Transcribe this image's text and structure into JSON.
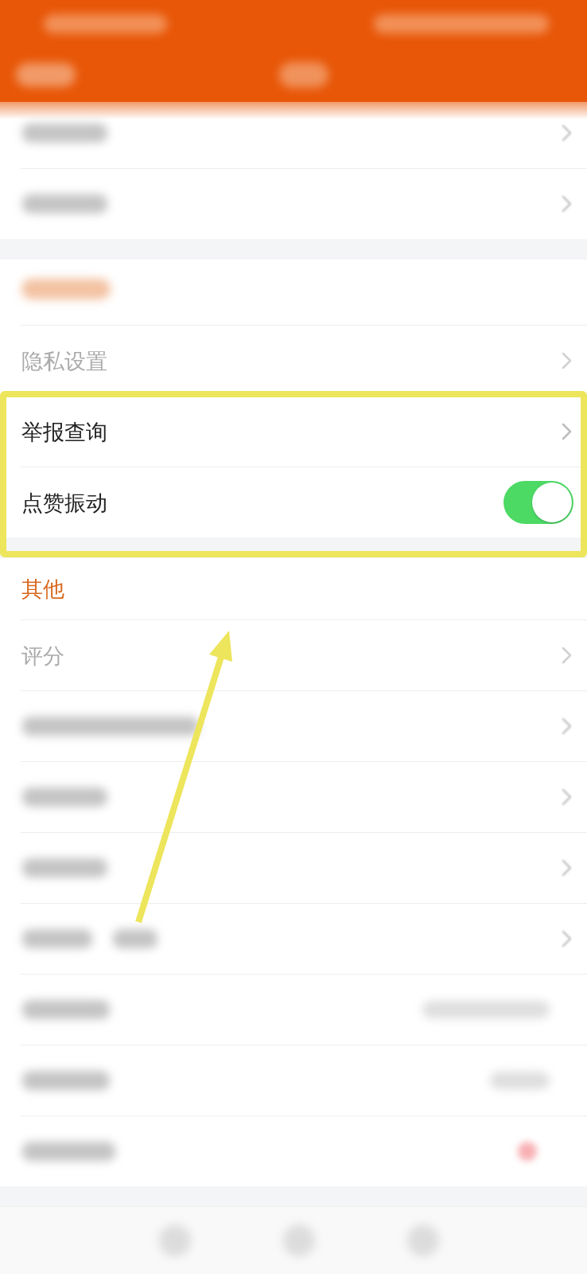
{
  "header": {
    "kind": "blurred"
  },
  "sections": [
    {
      "rows": [
        {
          "kind": "blurred",
          "trailing": {
            "kind": "chevron"
          },
          "highlighted": false
        },
        {
          "kind": "blurred",
          "trailing": {
            "kind": "chevron"
          },
          "highlighted": false
        }
      ]
    },
    {
      "title": {
        "kind": "blurred"
      },
      "rows": [
        {
          "kind": "link",
          "label": "隐私设置",
          "faded": true,
          "highlighted": false
        },
        {
          "kind": "link",
          "label": "举报查询",
          "faded": false,
          "highlighted": true
        },
        {
          "kind": "switch",
          "label": "点赞振动",
          "faded": false,
          "on": true,
          "highlighted": true
        }
      ]
    },
    {
      "title": {
        "kind": "text",
        "label": "其他"
      },
      "rows": [
        {
          "kind": "link",
          "label": "评分",
          "faded": true,
          "highlighted": false
        },
        {
          "kind": "blurred",
          "trailing": {
            "kind": "chevron"
          },
          "highlighted": false
        },
        {
          "kind": "blurred",
          "trailing": {
            "kind": "chevron"
          },
          "highlighted": false
        },
        {
          "kind": "blurred",
          "trailing": {
            "kind": "chevron"
          },
          "highlighted": false
        },
        {
          "kind": "blurred",
          "trailing": {
            "kind": "chevron"
          },
          "highlighted": false
        },
        {
          "kind": "blurred",
          "trailing": {
            "kind": "value"
          },
          "highlighted": false
        },
        {
          "kind": "blurred",
          "trailing": {
            "kind": "value"
          },
          "highlighted": false
        },
        {
          "kind": "blurred",
          "trailing": {
            "kind": "dot"
          },
          "highlighted": false
        }
      ]
    }
  ],
  "tab_bar": {
    "items": [
      {
        "kind": "blurred"
      },
      {
        "kind": "blurred"
      },
      {
        "kind": "blurred"
      }
    ]
  },
  "annotation": {
    "kind": "arrow"
  }
}
